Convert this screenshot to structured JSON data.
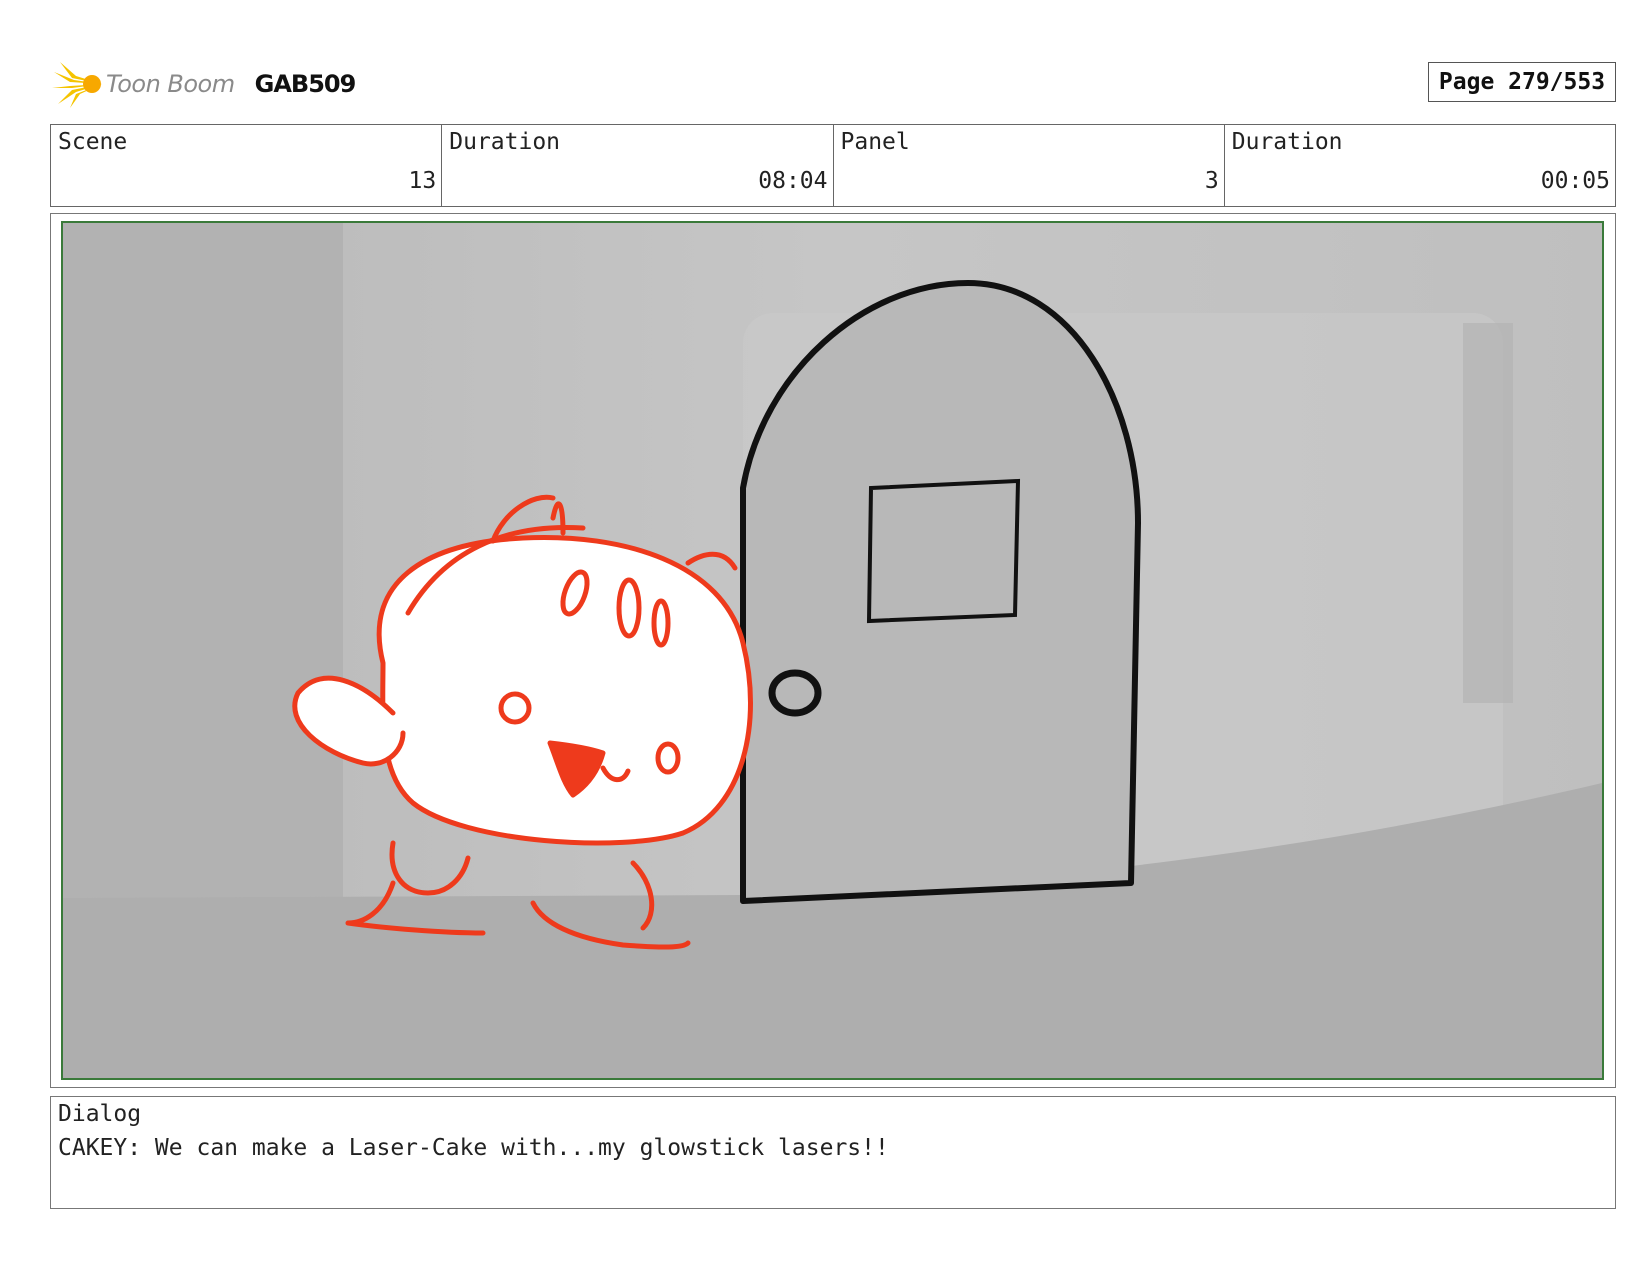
{
  "header": {
    "logo_text": "Toon Boom",
    "project_code": "GAB509",
    "page_label": "Page 279/553"
  },
  "info": [
    {
      "label": "Scene",
      "value": "13"
    },
    {
      "label": "Duration",
      "value": "08:04"
    },
    {
      "label": "Panel",
      "value": "3"
    },
    {
      "label": "Duration",
      "value": "00:05"
    }
  ],
  "dialog": {
    "label": "Dialog",
    "text": "CAKEY: We can make a Laser-Cake with...my glowstick lasers!!"
  },
  "colors": {
    "sketch_red": "#ee3a1c",
    "frame_green": "#3a7a3a",
    "logo_yellow": "#f5c400"
  },
  "icons": [
    "toon-boom-logo-icon"
  ]
}
